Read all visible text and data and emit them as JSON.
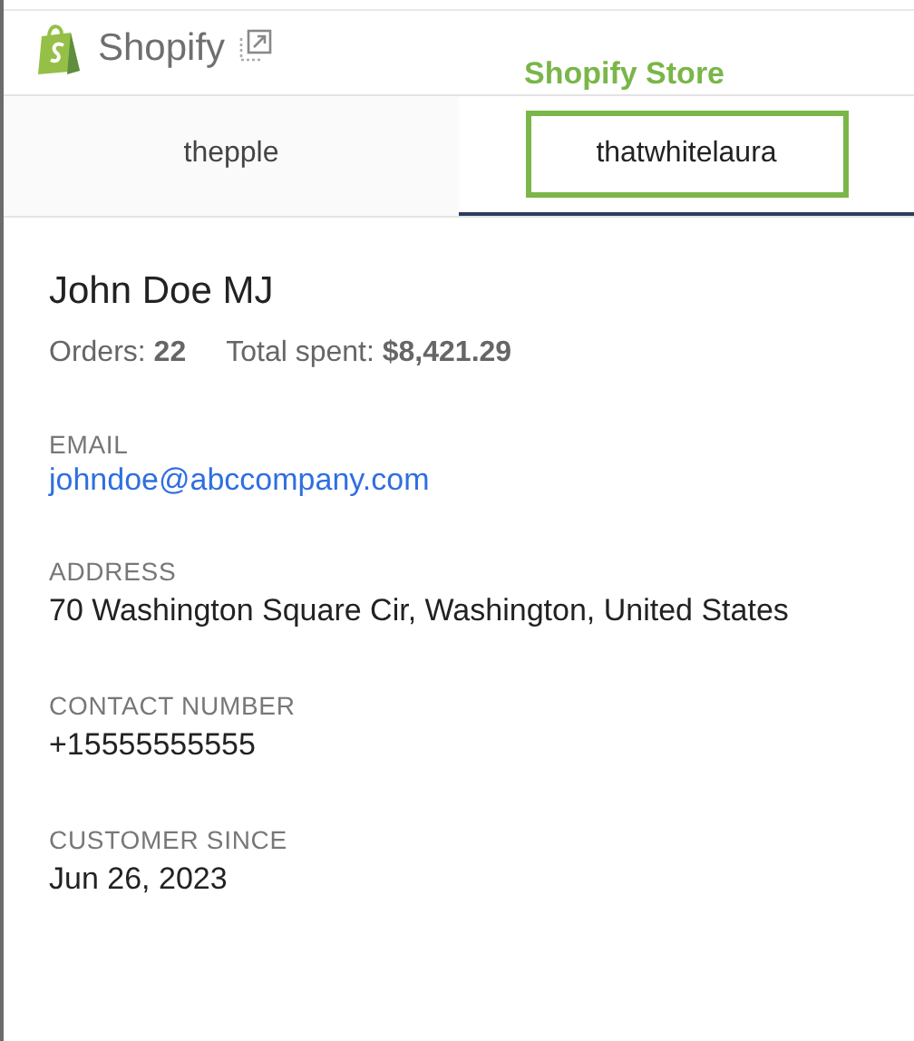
{
  "header": {
    "title": "Shopify"
  },
  "annotation": {
    "label": "Shopify Store"
  },
  "tabs": [
    {
      "label": "thepple",
      "selected": false
    },
    {
      "label": "thatwhitelaura",
      "selected": true
    }
  ],
  "customer": {
    "name": "John Doe MJ",
    "stats": [
      "Orders: **22**",
      "Total spent: **$8,421.29**"
    ]
  },
  "fields": [
    {
      "label": "EMAIL",
      "value": "johndoe@abccompany.com",
      "kind": "link"
    },
    {
      "label": "ADDRESS",
      "value": "70 Washington Square Cir, Washington, United States",
      "kind": "text"
    },
    {
      "label": "CONTACT NUMBER",
      "value": "+15555555555",
      "kind": "text"
    },
    {
      "label": "CUSTOMER SINCE",
      "value": "Jun 26, 2023",
      "kind": "text"
    }
  ]
}
